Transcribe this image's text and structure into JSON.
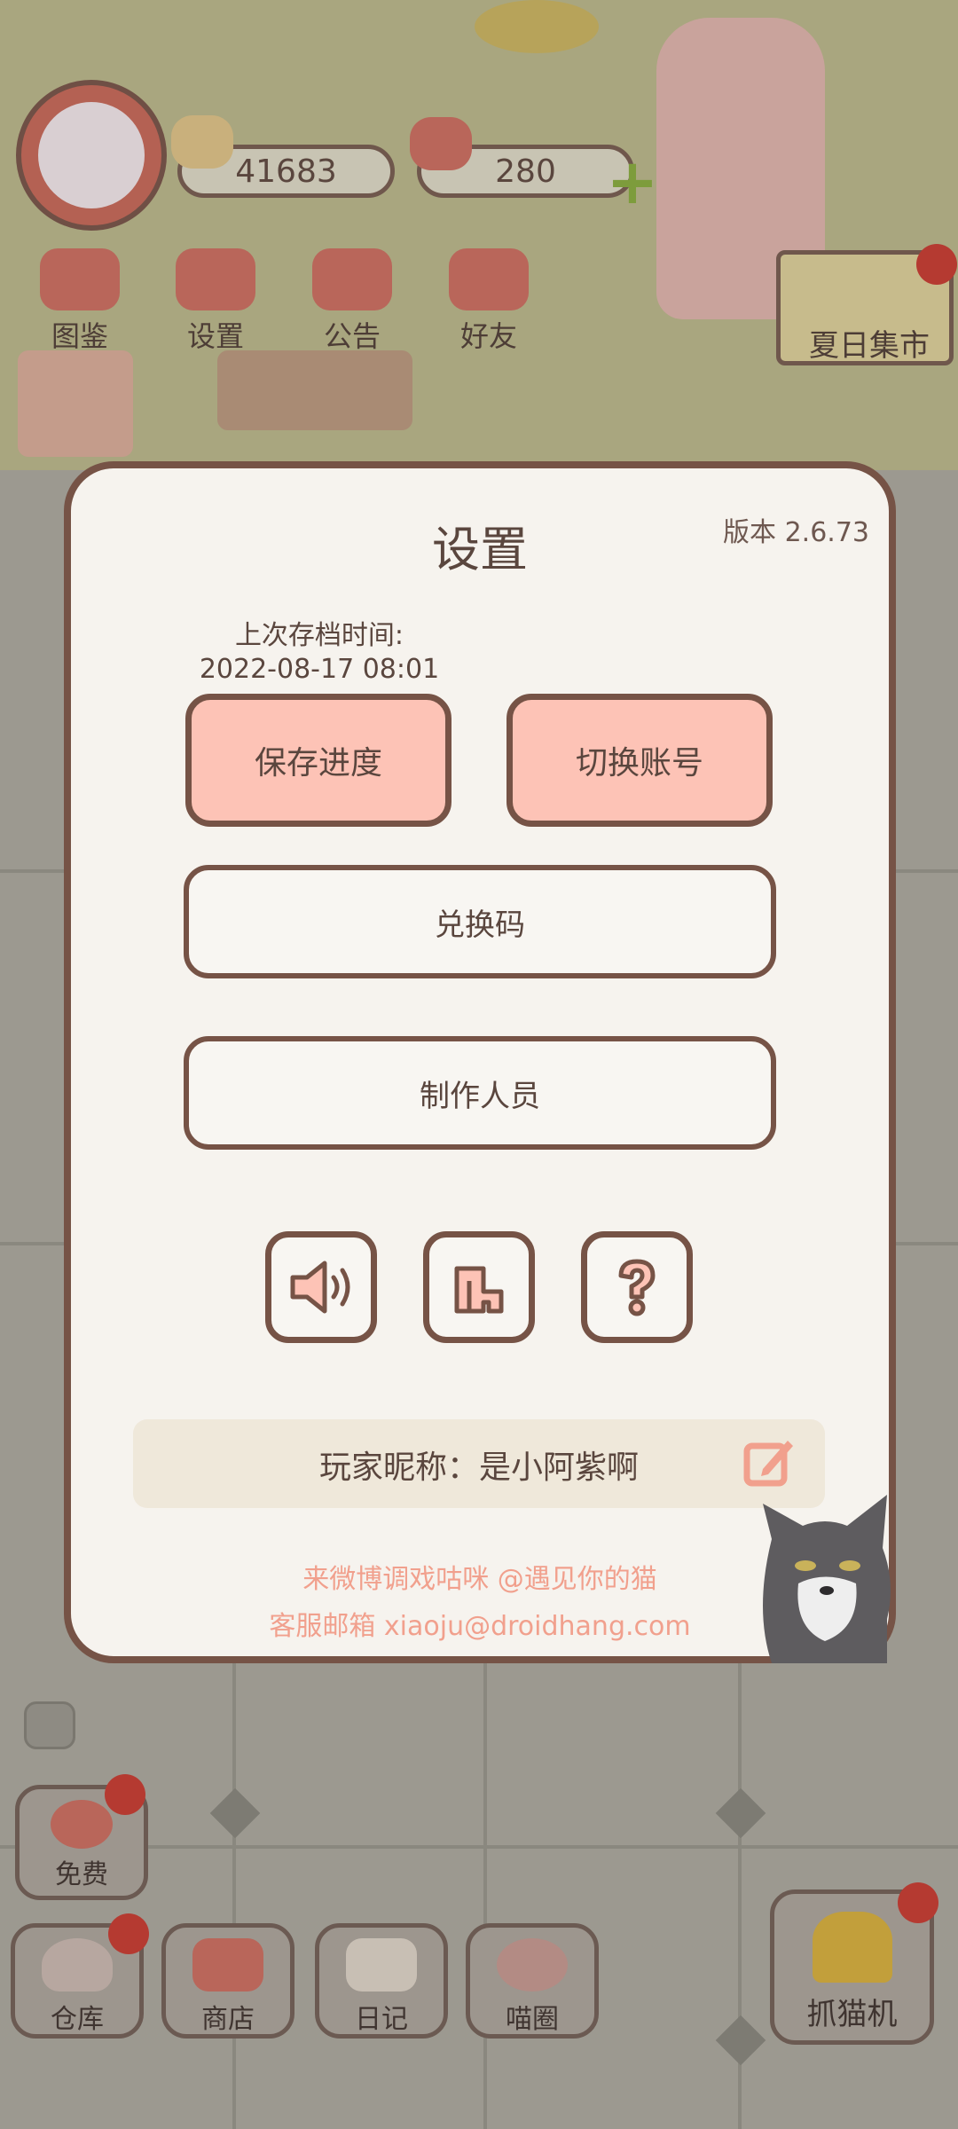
{
  "hud": {
    "fish_count": "41683",
    "heart_count": "280",
    "buttons": [
      {
        "label": "图鉴",
        "icon": "cat-book-icon"
      },
      {
        "label": "设置",
        "icon": "gear-icon"
      },
      {
        "label": "公告",
        "icon": "gift-icon"
      },
      {
        "label": "好友",
        "icon": "friends-icon"
      }
    ],
    "market_label": "夏日集市"
  },
  "modal": {
    "title": "设置",
    "version": "版本 2.6.73",
    "save_time_label": "上次存档时间:",
    "save_time_value": "2022-08-17 08:01",
    "save_button": "保存进度",
    "switch_account_button": "切换账号",
    "redeem_button": "兑换码",
    "credits_button": "制作人员",
    "nickname": "玩家昵称：是小阿紫啊",
    "weibo_text": "来微博调戏咕咪 @遇见你的猫",
    "support_email": "客服邮箱 xiaoju@droidhang.com"
  },
  "bottom": {
    "free_label": "免费",
    "warehouse_label": "仓库",
    "shop_label": "商店",
    "diary_label": "日记",
    "circle_label": "喵圈",
    "claw_label": "抓猫机"
  },
  "colors": {
    "modal_border": "#765346",
    "pink_button": "#fdc3b6",
    "footer_text": "#f1a08d",
    "notification": "#b53a31"
  }
}
